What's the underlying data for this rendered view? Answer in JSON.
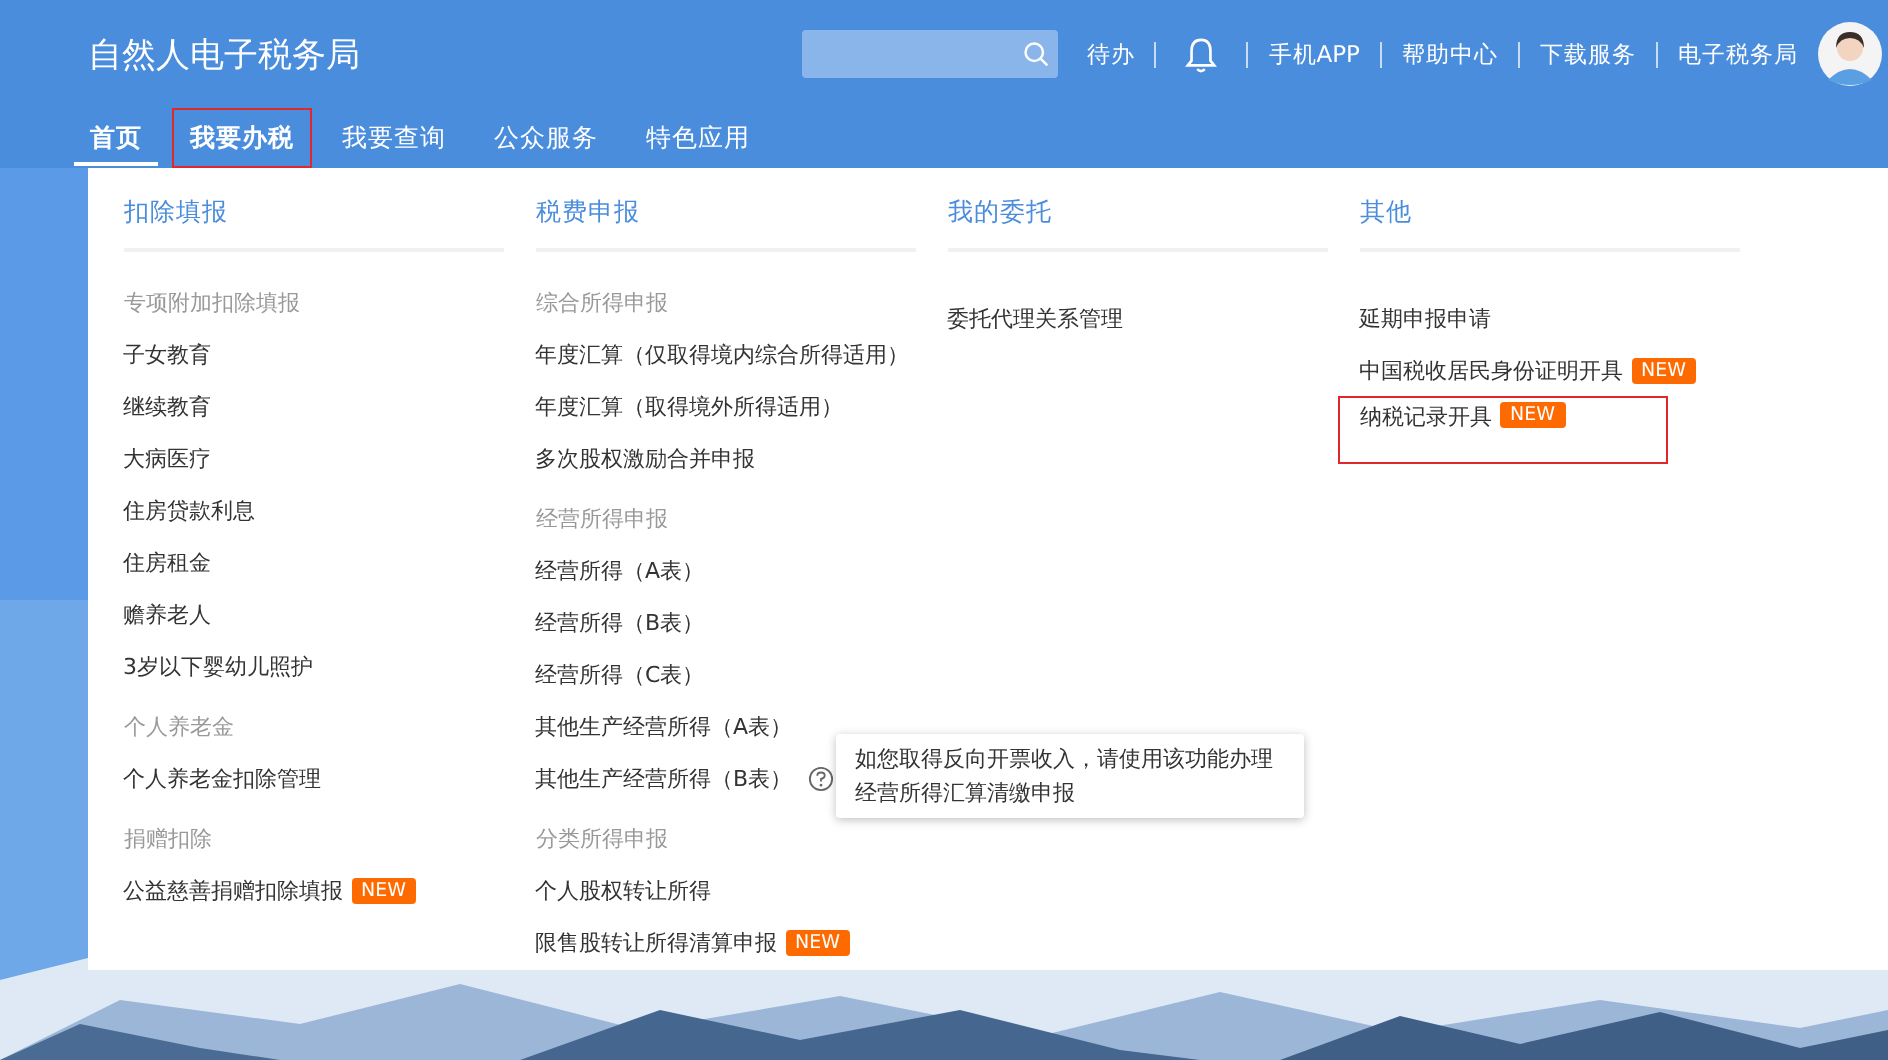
{
  "header": {
    "logo": "自然人电子税务局",
    "search": {
      "kind": "field"
    },
    "links": [
      {
        "kind": "text",
        "label": "待办"
      },
      {
        "kind": "bell"
      },
      {
        "kind": "text",
        "label": "手机APP"
      },
      {
        "kind": "text",
        "label": "帮助中心"
      },
      {
        "kind": "text",
        "label": "下载服务"
      },
      {
        "kind": "text",
        "label": "电子税务局"
      }
    ]
  },
  "tabs": [
    {
      "label": "首页",
      "selected": true,
      "highlighted": false
    },
    {
      "label": "我要办税",
      "selected": false,
      "highlighted": true
    },
    {
      "label": "我要查询",
      "selected": false,
      "highlighted": false
    },
    {
      "label": "公众服务",
      "selected": false,
      "highlighted": false
    },
    {
      "label": "特色应用",
      "selected": false,
      "highlighted": false
    }
  ],
  "menu": {
    "columns": [
      {
        "title": "扣除填报",
        "groups": [
          {
            "heading": "专项附加扣除填报",
            "items": [
              {
                "label": "子女教育",
                "highlighted": false
              },
              {
                "label": "继续教育",
                "highlighted": false
              },
              {
                "label": "大病医疗",
                "highlighted": false
              },
              {
                "label": "住房贷款利息",
                "highlighted": false
              },
              {
                "label": "住房租金",
                "highlighted": false
              },
              {
                "label": "赡养老人",
                "highlighted": false
              },
              {
                "label": "3岁以下婴幼儿照护",
                "highlighted": false
              }
            ]
          },
          {
            "heading": "个人养老金",
            "items": [
              {
                "label": "个人养老金扣除管理",
                "highlighted": false
              }
            ]
          },
          {
            "heading": "捐赠扣除",
            "items": [
              {
                "label": "公益慈善捐赠扣除填报",
                "badge": "NEW",
                "highlighted": false
              }
            ]
          }
        ]
      },
      {
        "title": "税费申报",
        "groups": [
          {
            "heading": "综合所得申报",
            "items": [
              {
                "label": "年度汇算（仅取得境内综合所得适用）",
                "highlighted": false
              },
              {
                "label": "年度汇算（取得境外所得适用）",
                "highlighted": false
              },
              {
                "label": "多次股权激励合并申报",
                "highlighted": false
              }
            ]
          },
          {
            "heading": "经营所得申报",
            "items": [
              {
                "label": "经营所得（A表）",
                "highlighted": false
              },
              {
                "label": "经营所得（B表）",
                "highlighted": false
              },
              {
                "label": "经营所得（C表）",
                "highlighted": false
              },
              {
                "label": "其他生产经营所得（A表）",
                "highlighted": false
              },
              {
                "label": "其他生产经营所得（B表）",
                "help": "如您取得反向开票收入，请使用该功能办理经营所得汇算清缴申报",
                "highlighted": false
              }
            ]
          },
          {
            "heading": "分类所得申报",
            "items": [
              {
                "label": "个人股权转让所得",
                "highlighted": false
              },
              {
                "label": "限售股转让所得清算申报",
                "badge": "NEW",
                "highlighted": false
              }
            ]
          }
        ]
      },
      {
        "title": "我的委托",
        "groups": [
          {
            "items": [
              {
                "label": "委托代理关系管理",
                "highlighted": false
              }
            ]
          }
        ]
      },
      {
        "title": "其他",
        "groups": [
          {
            "items": [
              {
                "label": "延期申报申请",
                "highlighted": false
              },
              {
                "label": "中国税收居民身份证明开具",
                "badge": "NEW",
                "highlighted": false
              },
              {
                "label": "纳税记录开具",
                "badge": "NEW",
                "highlighted": true
              }
            ]
          }
        ]
      }
    ]
  }
}
